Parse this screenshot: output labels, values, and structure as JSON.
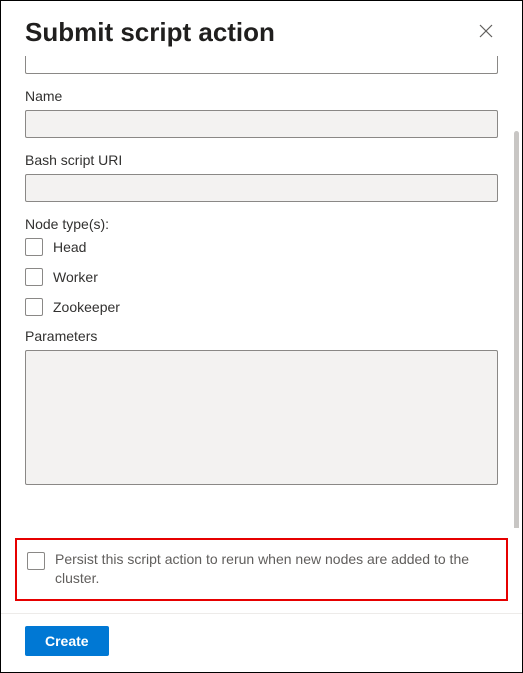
{
  "header": {
    "title": "Submit script action"
  },
  "form": {
    "name_label": "Name",
    "name_value": "",
    "uri_label": "Bash script URI",
    "uri_value": "",
    "node_types_label": "Node type(s):",
    "node_types": [
      {
        "label": "Head"
      },
      {
        "label": "Worker"
      },
      {
        "label": "Zookeeper"
      }
    ],
    "parameters_label": "Parameters",
    "parameters_value": "",
    "persist_label": "Persist this script action to rerun when new nodes are added to the cluster."
  },
  "footer": {
    "create_label": "Create"
  }
}
